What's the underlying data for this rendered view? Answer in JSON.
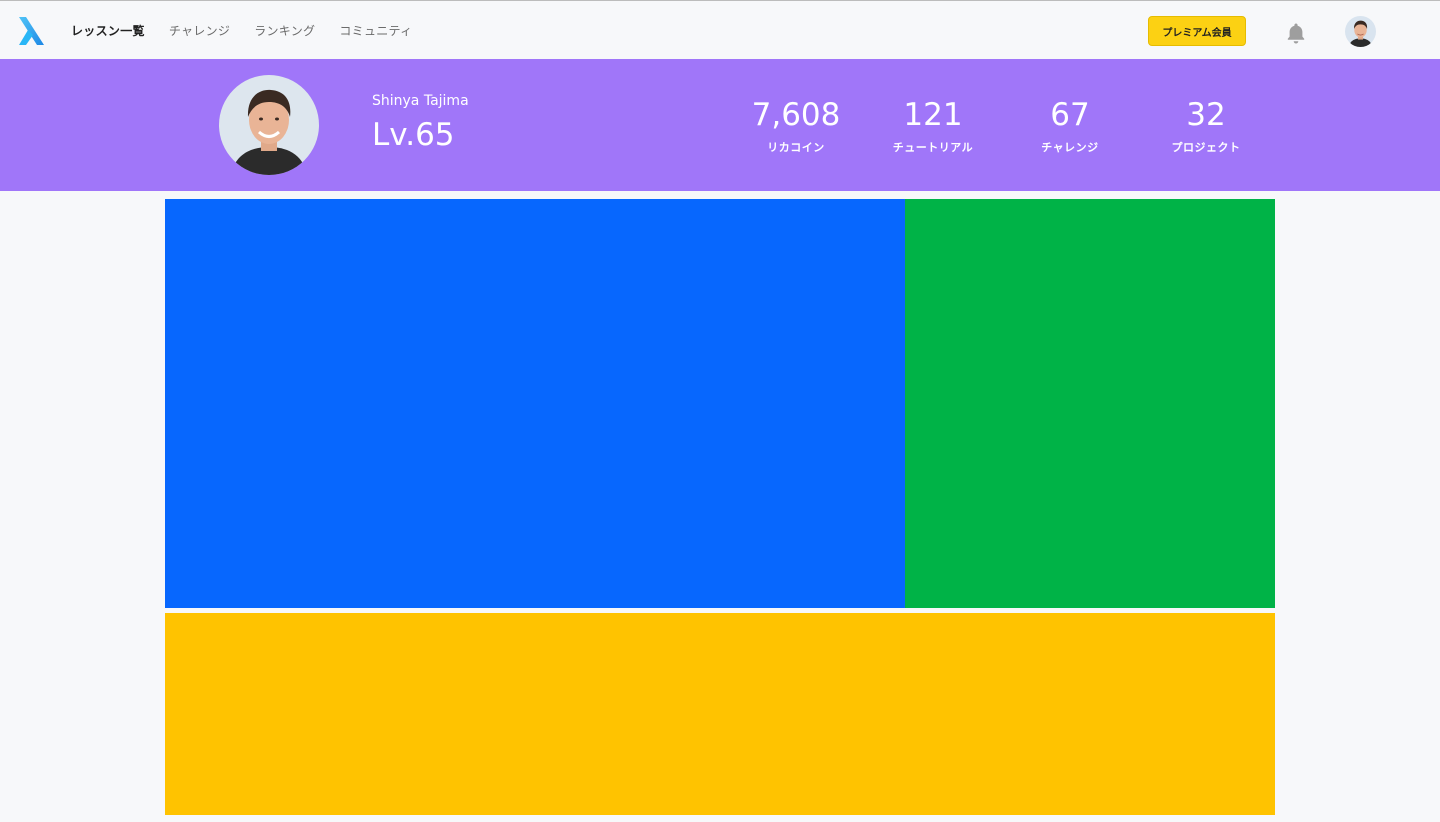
{
  "header": {
    "logo": "lambda-logo",
    "nav": [
      {
        "label": "レッスン一覧",
        "active": true
      },
      {
        "label": "チャレンジ",
        "active": false
      },
      {
        "label": "ランキング",
        "active": false
      },
      {
        "label": "コミュニティ",
        "active": false
      }
    ],
    "premium_label": "プレミアム会員",
    "bell_icon": "bell-icon",
    "avatar_icon": "user-avatar"
  },
  "profile": {
    "name": "Shinya Tajima",
    "level": "Lv.65",
    "stats": [
      {
        "value": "7,608",
        "label": "リカコイン"
      },
      {
        "value": "121",
        "label": "チュートリアル"
      },
      {
        "value": "67",
        "label": "チャレンジ"
      },
      {
        "value": "32",
        "label": "プロジェクト"
      }
    ]
  },
  "colors": {
    "band": "#a076f9",
    "premium": "#fcd113",
    "block_blue": "#0767fe",
    "block_green": "#00b347",
    "block_yellow": "#ffc300"
  }
}
